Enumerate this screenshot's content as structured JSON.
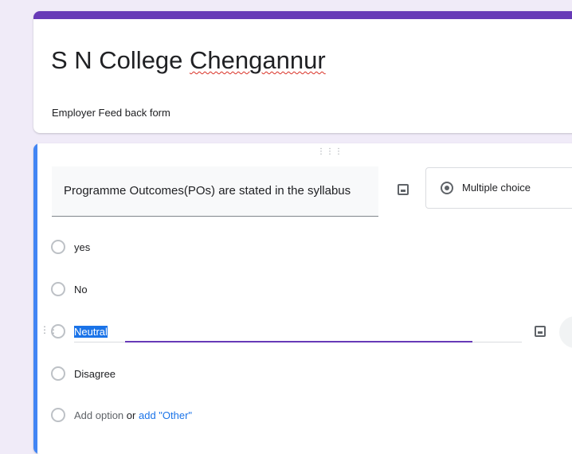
{
  "form": {
    "title_part1": "S N College ",
    "title_part2": "Chengannur",
    "description": "Employer Feed back form"
  },
  "question": {
    "text": "Programme Outcomes(POs) are stated in the syllabus",
    "type_label": "Multiple choice",
    "options": [
      {
        "label": "yes"
      },
      {
        "label": "No"
      },
      {
        "label": "Neutral"
      },
      {
        "label": "Disagree"
      }
    ],
    "add_option_label": "Add option",
    "or_text": "or",
    "add_other_label": "add \"Other\""
  },
  "colors": {
    "theme": "#673ab7",
    "active_border": "#4285f4",
    "link": "#1a73e8"
  }
}
